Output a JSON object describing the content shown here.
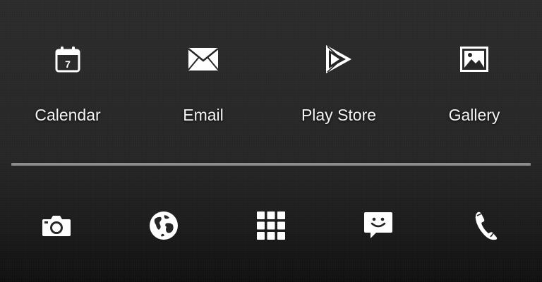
{
  "home_screen": {
    "apps": [
      {
        "label": "Calendar",
        "icon": "calendar-icon",
        "badge": "7"
      },
      {
        "label": "Email",
        "icon": "email-icon"
      },
      {
        "label": "Play Store",
        "icon": "play-store-icon"
      },
      {
        "label": "Gallery",
        "icon": "gallery-icon"
      }
    ]
  },
  "dock": {
    "items": [
      {
        "icon": "camera-icon"
      },
      {
        "icon": "browser-globe-icon"
      },
      {
        "icon": "app-drawer-icon"
      },
      {
        "icon": "messaging-icon"
      },
      {
        "icon": "phone-icon"
      }
    ]
  },
  "colors": {
    "background": "#262626",
    "text": "#f4f4f4",
    "divider": "#8c8c8c",
    "icon": "#ffffff"
  }
}
